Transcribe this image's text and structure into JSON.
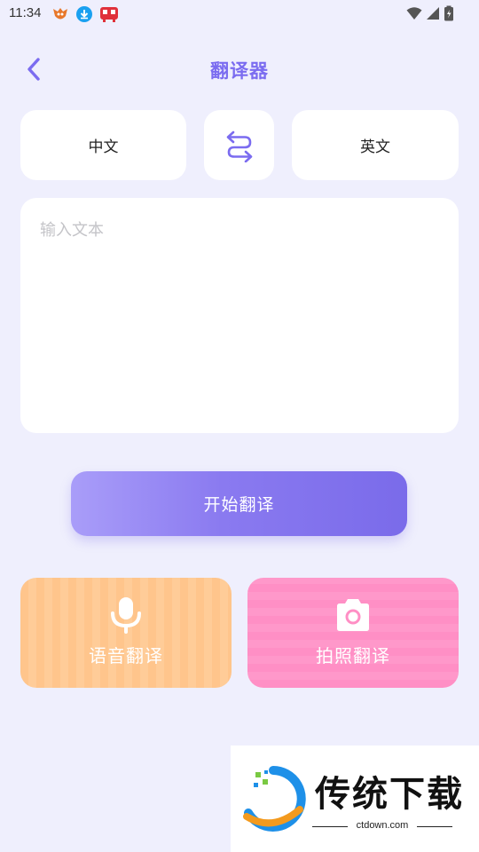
{
  "status_bar": {
    "time": "11:34"
  },
  "header": {
    "title": "翻译器"
  },
  "languages": {
    "source": "中文",
    "target": "英文"
  },
  "input": {
    "value": "",
    "placeholder": "输入文本"
  },
  "actions": {
    "start_label": "开始翻译",
    "voice_label": "语音翻译",
    "photo_label": "拍照翻译"
  },
  "watermark": {
    "text": "传统下载",
    "url": "ctdown.com"
  },
  "colors": {
    "accent": "#7b6cf0",
    "background": "#efeffd",
    "voice_card": "#ffc58c",
    "photo_card": "#ff8fc5"
  }
}
